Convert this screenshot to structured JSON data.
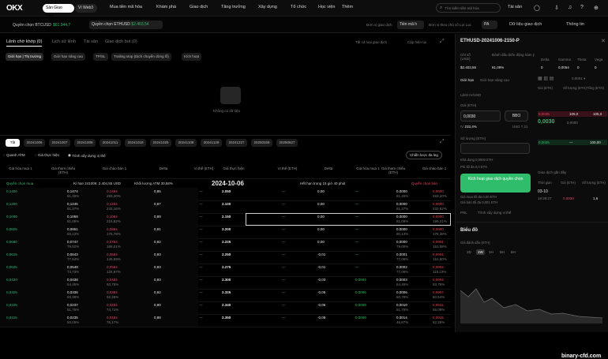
{
  "topbar": {
    "logo": "OKX",
    "tab_exchange": "Sàn Giao Dịch",
    "tab_web3": "Ví Web3",
    "nav": [
      "Mua tiền mã hóa",
      "Khám phá",
      "Giao dịch",
      "Tăng trưởng",
      "Xây dựng",
      "Tổ chức",
      "Học viện",
      "Thêm"
    ],
    "search_placeholder": "Tìm kiếm tiền mã hóa",
    "account": "Tài sản"
  },
  "subbar": {
    "btc": "Quyền chọn BTCUSD",
    "btc_val": "$61.944,7",
    "eth": "Quyền chọn ETHUSD",
    "eth_val": "$2.403,54",
    "expiry_label": "Đơn vị giao dịch",
    "expiry_val": "Tiền mã h",
    "unit_label": "Đơn vị theo chủ số Lợi Lọc",
    "unit_val": "PA",
    "data_link": "Dữ liệu giao dịch",
    "info_link": "Thông tin"
  },
  "left": {
    "tabs": [
      "Lệnh chờ khớp (0)",
      "Lịch sử lệnh",
      "Tài sản",
      "Giao dịch bot (0)"
    ],
    "all_types": "Tất cả loại giao dịch",
    "edit_label": "Cập hiện tại",
    "order_chips": [
      "Giới hạn | Thị trường",
      "Giới hạn nâng cao",
      "TP/SL",
      "Trailing stop (Dịch chuyển dừng lỗ)",
      "Kích hoạt"
    ],
    "empty": "Không có dữ liệu",
    "dates": [
      "Tất cả",
      "20241006",
      "20241007",
      "20241008",
      "20241011",
      "20241018",
      "20241025",
      "20241108",
      "20241129",
      "20241227",
      "20250328",
      "20250627"
    ],
    "toggles": [
      "Quanh ATM",
      "Giá thực hiện",
      "Trình xây dựng vị thế"
    ],
    "strategy": "Chiến lược đa leg",
    "hdr_calls": [
      "Giá hòa mua 1",
      "Giá tham chiếu (ETH)",
      "Giá chào bán 1",
      "Delta",
      "Vị thế (ETH)"
    ],
    "hdr_strike": "Giá thực hiện",
    "hdr_puts": [
      "Vị thế (ETH)",
      "Delta",
      "Giá hòa mua 1",
      "Giá tham chiếu (ETH)",
      "Giá chào bán 1"
    ],
    "call_label": "Quyền chọn mua",
    "expiry_info": "Kì hạn 241006: 2.404,55 USD",
    "atm_info": "Khối lượng ATM 30,58%",
    "expiry_date": "2024-10-06",
    "countdown": "Hết hạn trong 15 giờ 40 phút",
    "put_label": "Quyền chọn bán",
    "rows": [
      [
        "0,1400",
        "0,1474",
        "0,1494",
        "0,85",
        "—",
        "2.050",
        "—",
        "0,00",
        "—",
        "0,0000",
        "0,0000"
      ],
      [
        "0,1200",
        "0,1245",
        "0,1284",
        "0,87",
        "—",
        "2.100",
        "—",
        "0,00",
        "—",
        "0,0000",
        "0,0000"
      ],
      [
        "0,1000",
        "0,1059",
        "0,1084",
        "0,89",
        "—",
        "2.150",
        "—",
        "0,00",
        "—",
        "0,0000",
        "0,0000"
      ],
      [
        "0,0825",
        "0,0851",
        "0,0884",
        "0,91",
        "—",
        "2.200",
        "—",
        "0,00",
        "—",
        "0,0000",
        "0,0000"
      ],
      [
        "0,0680",
        "0,0747",
        "0,0784",
        "0,92",
        "—",
        "2.225",
        "—",
        "0,00",
        "—",
        "0,0000",
        "0,0001"
      ],
      [
        "0,0615",
        "0,0643",
        "0,0684",
        "0,93",
        "—",
        "2.250",
        "—",
        "-0,01",
        "—",
        "0,0001",
        "0,0001"
      ],
      [
        "0,0525",
        "0,0540",
        "0,0584",
        "0,93",
        "—",
        "2.275",
        "—",
        "-0,01",
        "—",
        "0,0002",
        "0,0002"
      ],
      [
        "0,0420",
        "0,0438",
        "0,0484",
        "0,93",
        "—",
        "2.300",
        "—",
        "-0,03",
        "0,0003",
        "0,0003",
        "0,0004"
      ],
      [
        "0,0325",
        "0,0336",
        "0,0384",
        "0,92",
        "—",
        "2.325",
        "—",
        "-0,05",
        "0,0005",
        "0,0006",
        "0,0007"
      ],
      [
        "0,0225",
        "0,0237",
        "0,0284",
        "0,90",
        "—",
        "2.340",
        "—",
        "-0,06",
        "0,0009",
        "0,0010",
        "0,0011"
      ],
      [
        "0,0215",
        "0,0235",
        "0,0184",
        "0,88",
        "—",
        "2.350",
        "—",
        "-0,09",
        "0,0009",
        "0,0014",
        "0,0015"
      ]
    ],
    "row_pct": [
      [
        "81,45%",
        "283,20%"
      ],
      [
        "81,37%",
        "243,16%"
      ],
      [
        "81,09%",
        "215,82%"
      ],
      [
        "80,13%",
        "175,78%"
      ],
      [
        "79,02%",
        "166,01%"
      ],
      [
        "77,64%",
        "145,99%"
      ],
      [
        "73,73%",
        "125,97%"
      ],
      [
        "64,45%",
        "93,75%"
      ],
      [
        "60,38%",
        "92,28%"
      ],
      [
        "51,75%",
        "74,71%"
      ],
      [
        "50,05%",
        "76,17%"
      ]
    ],
    "row_pct_put": [
      [
        "81,45%",
        "283,20%"
      ],
      [
        "81,37%",
        "232,62%"
      ],
      [
        "81,09%",
        "199,21%"
      ],
      [
        "80,13%",
        "178,38%"
      ],
      [
        "79,00%",
        "163,08%"
      ],
      [
        "77,06%",
        "151,80%"
      ],
      [
        "77,06%",
        "115,23%"
      ],
      [
        "64,45%",
        "93,75%"
      ],
      [
        "50,78%",
        "60,54%"
      ],
      [
        "51,75%",
        "55,09%"
      ],
      [
        "46,87%",
        "52,26%"
      ]
    ]
  },
  "right": {
    "instrument": "ETHUSD-20241006-2150-P",
    "cols": [
      "Chỉ số (USD)",
      "Đánh dấu biến động hàm ý",
      "Delta",
      "Gamma",
      "Theta",
      "Vega"
    ],
    "vals": [
      "$2.403,55",
      "81,09%",
      "0",
      "0,0054",
      "0",
      "0"
    ],
    "order_tabs": [
      "Giới hạn",
      "Giới hạn nâng cao"
    ],
    "iv_mode": "Lệnh IV/USD",
    "price_label": "Giá (ETH)",
    "price": "0,0030",
    "bbo": "BBO",
    "iv": "233,4%",
    "usd": "USD 7,21",
    "qty_label": "Số lượng (ETH)",
    "avail": "Khả dụng 0,0000 ETH",
    "fee": "Phí tối đa 0,0 ETH",
    "max_buy": "Giá mua tối đa 0,00 ETH",
    "max_sell": "Giá bán tối đa 0,001 ETH",
    "submit": "Kích hoạt giao dịch quyền chọn",
    "pnl": "PNL",
    "builder": "Trình xây dựng vị thế",
    "book_hdr": [
      "Giá (ETH)",
      "Số lượng (ETH)",
      "Tổng (ETH)"
    ],
    "ask": [
      "0,0035",
      "105,0",
      "105,0"
    ],
    "mid_price": "0,0030",
    "mid_usd": "0,0000",
    "bid": [
      "0,0025",
      "—",
      "100,00"
    ],
    "recent": "Giao dịch gần đây",
    "trade_hdr": [
      "Thời gian",
      "Giá (ETH)",
      "Số lượng (ETH)"
    ],
    "trade_date": "03-10",
    "trade": [
      "18:28:27",
      "0,0030",
      "1,6"
    ],
    "chart_title": "Biểu đồ",
    "chart_legend": "Giá đánh dấu (ETH)",
    "ranges": [
      "1D",
      "1W",
      "1H",
      "5H",
      "6H"
    ],
    "watermark": "binary-cfd.com"
  }
}
